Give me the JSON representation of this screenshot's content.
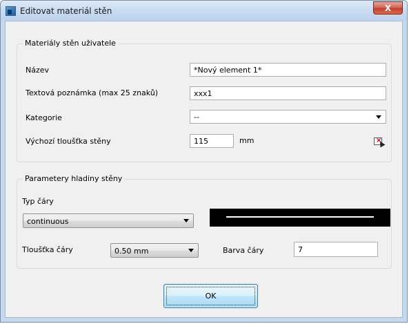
{
  "window": {
    "title": "Editovat materiál stěn",
    "close_glyph": "X"
  },
  "user_materials": {
    "legend": "Materiály stěn uživatele",
    "name_label": "Název",
    "name_value": "*Nový element 1*",
    "note_label": "Textová poznámka (max 25 znaků)",
    "note_value": "xxx1",
    "category_label": "Kategorie",
    "category_value": "--",
    "thickness_label": "Výchozí tloušťka stěny",
    "thickness_value": "115",
    "thickness_unit": "mm",
    "pick_icon": "pick-from-drawing-icon"
  },
  "layer_params": {
    "legend": "Parametery hladiny stěny",
    "linetype_label": "Typ čáry",
    "linetype_value": "continuous",
    "linewidth_label": "Tloušťka čáry",
    "linewidth_value": "0.50 mm",
    "linecolor_label": "Barva čáry",
    "linecolor_value": "7"
  },
  "buttons": {
    "ok_label": "OK"
  }
}
